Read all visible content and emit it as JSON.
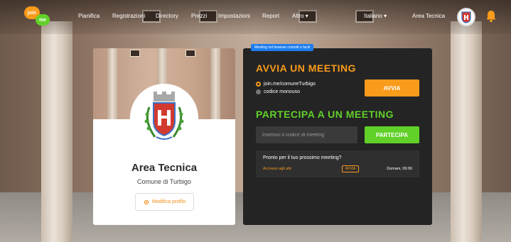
{
  "app": {
    "logo_top": "join",
    "logo_bottom": "me"
  },
  "nav": {
    "items": [
      "Pianifica",
      "Registrazioni",
      "Directory",
      "Prezzi",
      "Impostazioni",
      "Report",
      "Altro ▾"
    ],
    "language": "Italiano ▾",
    "user_name": "Area Tecnica",
    "icons": {
      "avatar": "crest-avatar",
      "bell": "bell-icon"
    }
  },
  "profile": {
    "name": "Area Tecnica",
    "subtitle": "Comune di Turbigo",
    "edit_label": "Modifica profilo"
  },
  "meeting": {
    "tooltip": "Meeting nel browser comodi e facili",
    "start_heading": "AVVIA UN MEETING",
    "options": [
      "join.me/comuneTurbigo",
      "codice monouso"
    ],
    "selected_option": "join.me/comuneTurbigo",
    "start_button": "AVVIA",
    "join_heading": "PARTECIPA A UN MEETING",
    "code_placeholder": "Inserisci il codice di meeting",
    "join_button": "PARTECIPA",
    "upcoming": {
      "title": "Pronto per il tuo prossimo meeting?",
      "link": "Accesso agli atti",
      "badge": "AVVIA",
      "time": "Domani, 09:00"
    }
  },
  "colors": {
    "orange": "#f99b1b",
    "green": "#61d12a",
    "panel": "#242424",
    "tooltip": "#1d7df0"
  }
}
